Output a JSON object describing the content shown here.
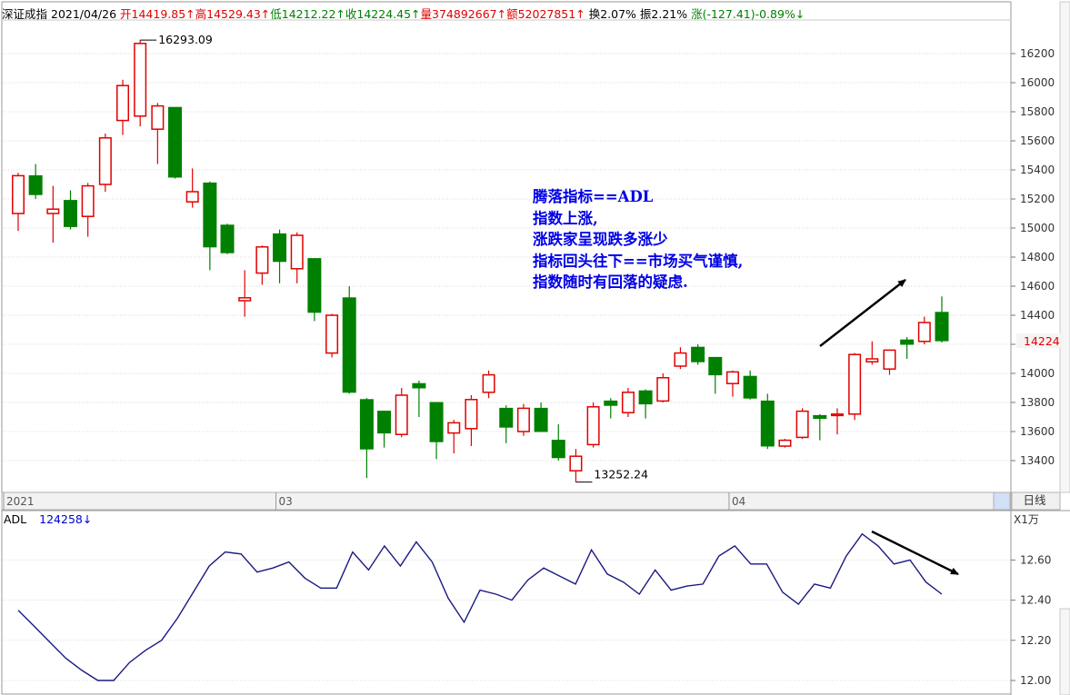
{
  "header": {
    "name": "深证成指",
    "date": "2021/04/26",
    "open": "开14419.85↑",
    "high": "高14529.43↑",
    "low": "低14212.22↑",
    "close": "收14224.45↑",
    "volume": "量374892667↑",
    "amount": "额52027851↑",
    "turnover": "换2.07%",
    "amplitude": "振2.21%",
    "change": "涨(-127.41)-0.89%↓"
  },
  "annotation": {
    "line1": "腾落指标==ADL",
    "line2": "指数上涨,",
    "line3": "涨跌家呈现跌多涨少",
    "line4": "指标回头往下==市场买气谨慎,",
    "line5": "指数随时有回落的疑虑."
  },
  "adl_header": {
    "label": "ADL",
    "value": "124258↓"
  },
  "right_tabs": {
    "period": "日线",
    "ratio": "X1万"
  },
  "colors": {
    "up": "#e00000",
    "down": "#008000",
    "adl": "#1a1a80",
    "arrow": "#000000",
    "annotation": "#0000e6",
    "last_price": "#e00000"
  },
  "chart_data": [
    {
      "type": "candlestick",
      "price_axis": {
        "ticks": [
          13400,
          13600,
          13800,
          14000,
          14200,
          14400,
          14600,
          14800,
          15000,
          15200,
          15400,
          15600,
          15800,
          16000,
          16200
        ],
        "range": [
          13200,
          16500
        ],
        "position": "right"
      },
      "last_price_label": "14224",
      "max_label": "16293.09",
      "min_label": "13252.24",
      "x_axis_labels": [
        "2021",
        "03",
        "04"
      ],
      "x_axis_label_index": [
        0,
        15,
        41
      ],
      "candles": [
        {
          "o": 15100,
          "h": 15380,
          "l": 14980,
          "c": 15360
        },
        {
          "o": 15360,
          "h": 15440,
          "l": 15200,
          "c": 15230
        },
        {
          "o": 15100,
          "h": 15290,
          "l": 14900,
          "c": 15130
        },
        {
          "o": 15190,
          "h": 15260,
          "l": 14990,
          "c": 15010
        },
        {
          "o": 15080,
          "h": 15310,
          "l": 14940,
          "c": 15290
        },
        {
          "o": 15300,
          "h": 15650,
          "l": 15250,
          "c": 15620
        },
        {
          "o": 15740,
          "h": 16020,
          "l": 15640,
          "c": 15980
        },
        {
          "o": 15770,
          "h": 16293.09,
          "l": 15700,
          "c": 16270
        },
        {
          "o": 15680,
          "h": 15860,
          "l": 15440,
          "c": 15840
        },
        {
          "o": 15830,
          "h": 15830,
          "l": 15340,
          "c": 15350
        },
        {
          "o": 15180,
          "h": 15410,
          "l": 15140,
          "c": 15250
        },
        {
          "o": 15310,
          "h": 15320,
          "l": 14710,
          "c": 14870
        },
        {
          "o": 15020,
          "h": 15030,
          "l": 14820,
          "c": 14830
        },
        {
          "o": 14500,
          "h": 14710,
          "l": 14390,
          "c": 14520
        },
        {
          "o": 14690,
          "h": 14880,
          "l": 14610,
          "c": 14870
        },
        {
          "o": 14960,
          "h": 14990,
          "l": 14620,
          "c": 14770
        },
        {
          "o": 14720,
          "h": 14970,
          "l": 14620,
          "c": 14950
        },
        {
          "o": 14790,
          "h": 14790,
          "l": 14360,
          "c": 14420
        },
        {
          "o": 14140,
          "h": 14410,
          "l": 14110,
          "c": 14400
        },
        {
          "o": 14520,
          "h": 14600,
          "l": 13860,
          "c": 13870
        },
        {
          "o": 13820,
          "h": 13830,
          "l": 13280,
          "c": 13480
        },
        {
          "o": 13740,
          "h": 13740,
          "l": 13490,
          "c": 13590
        },
        {
          "o": 13580,
          "h": 13900,
          "l": 13560,
          "c": 13850
        },
        {
          "o": 13930,
          "h": 13950,
          "l": 13700,
          "c": 13900
        },
        {
          "o": 13800,
          "h": 13800,
          "l": 13410,
          "c": 13530
        },
        {
          "o": 13590,
          "h": 13680,
          "l": 13450,
          "c": 13660
        },
        {
          "o": 13620,
          "h": 13850,
          "l": 13500,
          "c": 13820
        },
        {
          "o": 13870,
          "h": 14020,
          "l": 13830,
          "c": 13990
        },
        {
          "o": 13760,
          "h": 13780,
          "l": 13520,
          "c": 13630
        },
        {
          "o": 13600,
          "h": 13790,
          "l": 13570,
          "c": 13760
        },
        {
          "o": 13760,
          "h": 13800,
          "l": 13600,
          "c": 13600
        },
        {
          "o": 13540,
          "h": 13650,
          "l": 13400,
          "c": 13420
        },
        {
          "o": 13330,
          "h": 13480,
          "l": 13252.24,
          "c": 13430
        },
        {
          "o": 13510,
          "h": 13800,
          "l": 13490,
          "c": 13770
        },
        {
          "o": 13810,
          "h": 13830,
          "l": 13690,
          "c": 13780
        },
        {
          "o": 13730,
          "h": 13900,
          "l": 13700,
          "c": 13870
        },
        {
          "o": 13880,
          "h": 13890,
          "l": 13690,
          "c": 13790
        },
        {
          "o": 13810,
          "h": 14000,
          "l": 13800,
          "c": 13970
        },
        {
          "o": 14050,
          "h": 14180,
          "l": 14030,
          "c": 14140
        },
        {
          "o": 14180,
          "h": 14200,
          "l": 14060,
          "c": 14080
        },
        {
          "o": 14110,
          "h": 14110,
          "l": 13860,
          "c": 13990
        },
        {
          "o": 13930,
          "h": 14020,
          "l": 13840,
          "c": 14010
        },
        {
          "o": 13980,
          "h": 14020,
          "l": 13820,
          "c": 13830
        },
        {
          "o": 13810,
          "h": 13860,
          "l": 13480,
          "c": 13500
        },
        {
          "o": 13500,
          "h": 13550,
          "l": 13490,
          "c": 13540
        },
        {
          "o": 13560,
          "h": 13760,
          "l": 13550,
          "c": 13740
        },
        {
          "o": 13710,
          "h": 13720,
          "l": 13540,
          "c": 13690
        },
        {
          "o": 13710,
          "h": 13760,
          "l": 13580,
          "c": 13720
        },
        {
          "o": 13720,
          "h": 14140,
          "l": 13680,
          "c": 14130
        },
        {
          "o": 14080,
          "h": 14220,
          "l": 14060,
          "c": 14100
        },
        {
          "o": 14030,
          "h": 14160,
          "l": 13990,
          "c": 14160
        },
        {
          "o": 14230,
          "h": 14250,
          "l": 14100,
          "c": 14200
        },
        {
          "o": 14220,
          "h": 14390,
          "l": 14200,
          "c": 14350
        },
        {
          "o": 14420,
          "h": 14529.43,
          "l": 14212.22,
          "c": 14224.45
        }
      ]
    },
    {
      "type": "line",
      "y_axis": {
        "ticks": [
          12.0,
          12.2,
          12.4,
          12.6
        ],
        "tick_labels": [
          "12.00",
          "12.20",
          "12.40",
          "12.60"
        ],
        "range": [
          11.95,
          12.76
        ],
        "position": "right"
      },
      "values": [
        12.35,
        12.27,
        12.19,
        12.11,
        12.05,
        12.0,
        12.0,
        12.09,
        12.15,
        12.2,
        12.31,
        12.44,
        12.57,
        12.64,
        12.63,
        12.54,
        12.56,
        12.59,
        12.51,
        12.46,
        12.46,
        12.64,
        12.55,
        12.67,
        12.57,
        12.69,
        12.59,
        12.41,
        12.29,
        12.45,
        12.43,
        12.4,
        12.5,
        12.56,
        12.52,
        12.48,
        12.65,
        12.53,
        12.49,
        12.43,
        12.55,
        12.45,
        12.47,
        12.48,
        12.62,
        12.67,
        12.58,
        12.58,
        12.44,
        12.38,
        12.48,
        12.46,
        12.62,
        12.73,
        12.67,
        12.58,
        12.6,
        12.49,
        12.43
      ]
    }
  ]
}
